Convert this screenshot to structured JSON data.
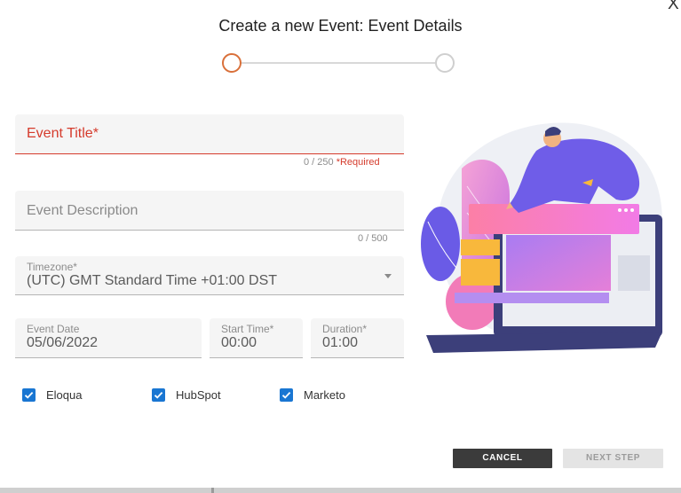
{
  "dialog": {
    "title": "Create a new Event: Event Details",
    "close_label": "X"
  },
  "stepper": {
    "current_step": 1,
    "total_steps": 2,
    "colors": {
      "active": "#d9703a",
      "inactive": "#cfcfcf"
    }
  },
  "form": {
    "event_title": {
      "placeholder": "Event Title*",
      "value": "",
      "counter": "0 / 250",
      "required_text": "*Required"
    },
    "event_description": {
      "placeholder": "Event Description",
      "value": "",
      "counter": "0 / 500"
    },
    "timezone": {
      "label": "Timezone*",
      "value": "(UTC) GMT Standard Time +01:00 DST"
    },
    "event_date": {
      "label": "Event Date",
      "value": "05/06/2022"
    },
    "start_time": {
      "label": "Start Time*",
      "value": "00:00"
    },
    "duration": {
      "label": "Duration*",
      "value": "01:00"
    },
    "integrations": [
      {
        "label": "Eloqua",
        "checked": true
      },
      {
        "label": "HubSpot",
        "checked": true
      },
      {
        "label": "Marketo",
        "checked": true
      }
    ]
  },
  "actions": {
    "cancel_label": "CANCEL",
    "next_label": "NEXT STEP"
  },
  "colors": {
    "error": "#d53b2c",
    "checkbox": "#1976d2",
    "cancel_bg": "#3b3b3b"
  },
  "illustration": {
    "icon": "person-with-laptop-illustration"
  }
}
